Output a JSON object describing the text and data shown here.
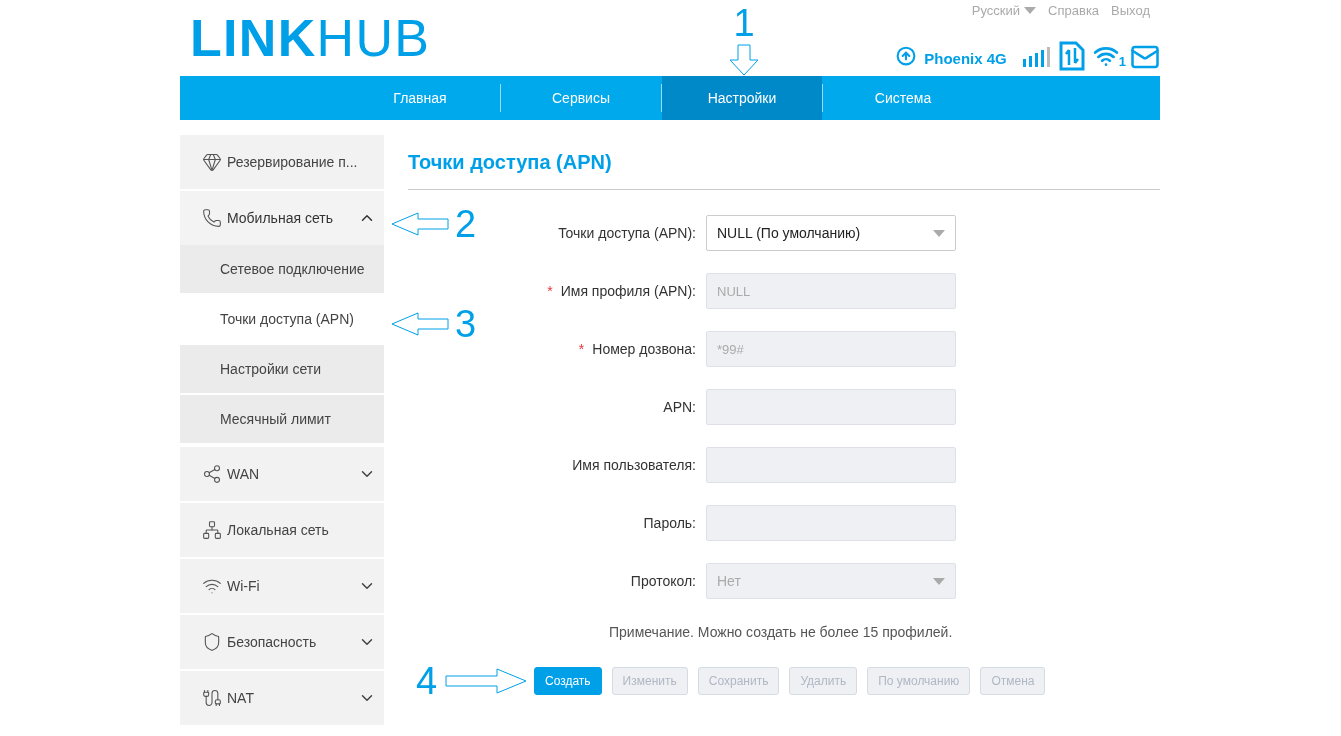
{
  "header": {
    "logo_bold": "LINK",
    "logo_light": "HUB",
    "top_links": [
      {
        "label": "Русский",
        "kind": "dropdown"
      },
      {
        "label": "Справка",
        "kind": "link"
      },
      {
        "label": "Выход",
        "kind": "link"
      }
    ],
    "operator": "Phoenix 4G",
    "wifi_clients": "1"
  },
  "nav": [
    {
      "label": "Главная",
      "selected": false
    },
    {
      "label": "Сервисы",
      "selected": false
    },
    {
      "label": "Настройки",
      "selected": true
    },
    {
      "label": "Система",
      "selected": false
    }
  ],
  "sidebar": [
    {
      "label": "Резервирование п..."
    },
    {
      "label": "Мобильная сеть",
      "expanded": true,
      "children": [
        {
          "label": "Сетевое подключение",
          "selected": false
        },
        {
          "label": "Точки доступа (APN)",
          "selected": true
        },
        {
          "label": "Настройки сети",
          "selected": false
        },
        {
          "label": "Месячный лимит",
          "selected": false
        }
      ]
    },
    {
      "label": "WAN",
      "expanded": false
    },
    {
      "label": "Локальная сеть"
    },
    {
      "label": "Wi-Fi",
      "expanded": false
    },
    {
      "label": "Безопасность",
      "expanded": false
    },
    {
      "label": "NAT",
      "expanded": false
    }
  ],
  "page_title": "Точки доступа (APN)",
  "form": [
    {
      "label": "Точки доступа (APN):",
      "kind": "select",
      "value": "NULL (По умолчанию)",
      "required": false,
      "disabled": false
    },
    {
      "label": "Имя профиля (APN):",
      "kind": "input",
      "placeholder": "NULL",
      "required": true,
      "disabled": true
    },
    {
      "label": "Номер дозвона:",
      "kind": "input",
      "placeholder": "*99#",
      "required": true,
      "disabled": true
    },
    {
      "label": "APN:",
      "kind": "input",
      "required": false,
      "disabled": true
    },
    {
      "label": "Имя пользователя:",
      "kind": "input",
      "required": false,
      "disabled": true
    },
    {
      "label": "Пароль:",
      "kind": "input",
      "required": false,
      "disabled": true
    },
    {
      "label": "Протокол:",
      "kind": "select",
      "value": "Нет",
      "required": false,
      "disabled": true
    }
  ],
  "required_mark": "*",
  "note": "Примечание. Можно создать не более 15 профилей.",
  "buttons": [
    {
      "label": "Создать",
      "disabled": false
    },
    {
      "label": "Изменить",
      "disabled": true
    },
    {
      "label": "Сохранить",
      "disabled": true
    },
    {
      "label": "Удалить",
      "disabled": true
    },
    {
      "label": "По умолчанию",
      "disabled": true
    },
    {
      "label": "Отмена",
      "disabled": true
    }
  ],
  "annotations": [
    {
      "label": "1"
    },
    {
      "label": "2"
    },
    {
      "label": "3"
    },
    {
      "label": "4"
    }
  ]
}
